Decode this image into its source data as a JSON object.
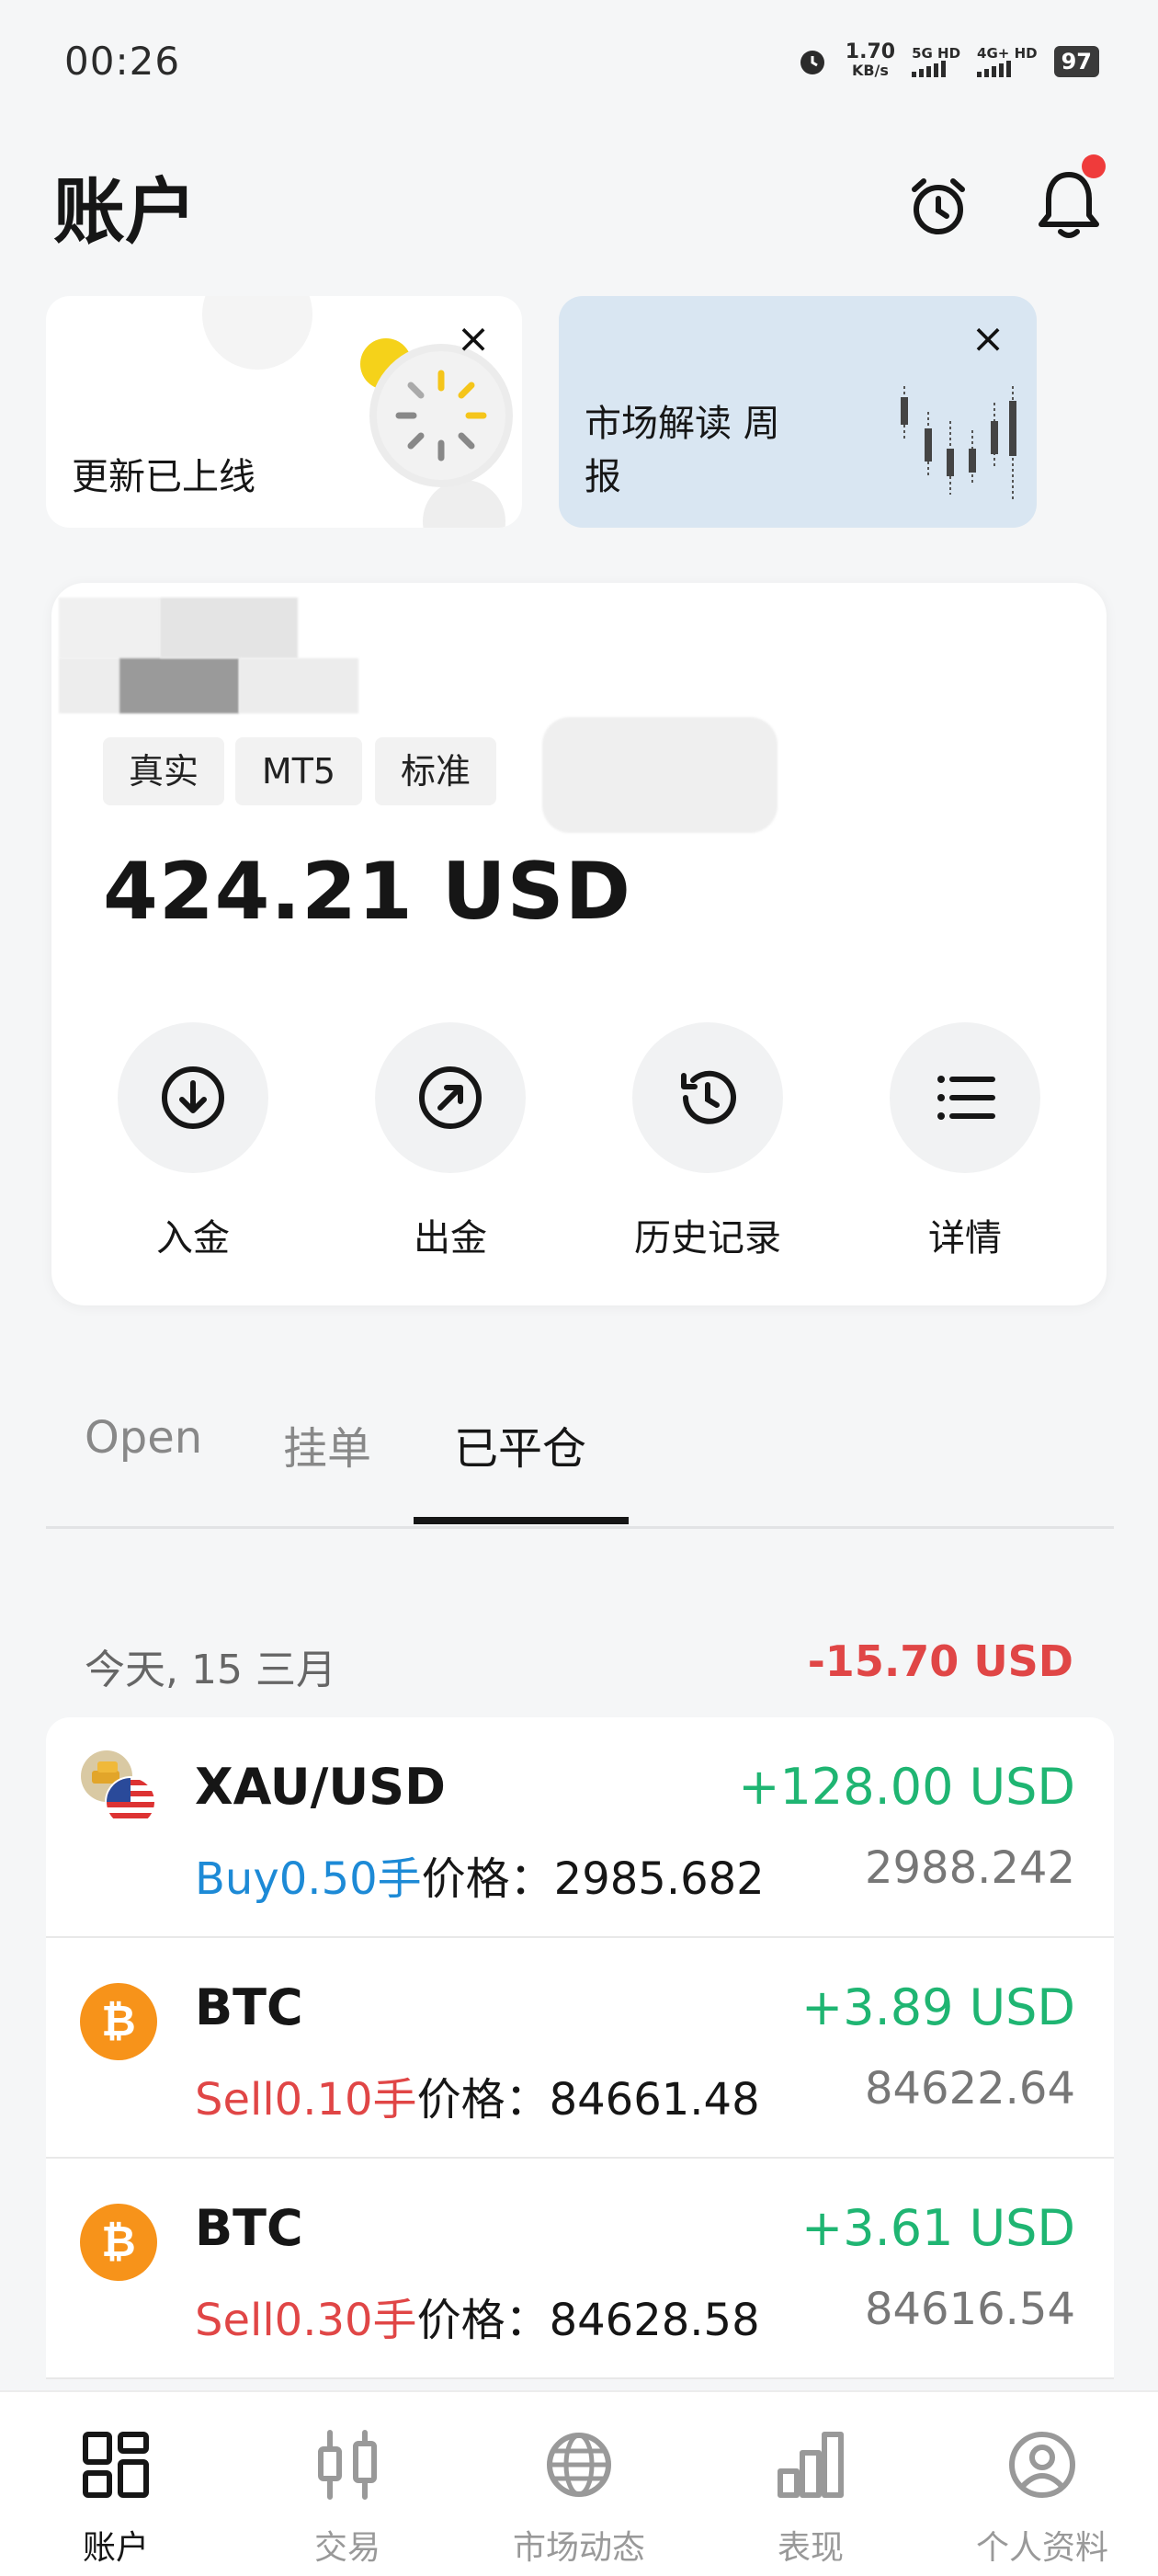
{
  "status_bar": {
    "time": "00:26",
    "speed_value": "1.70",
    "speed_unit": "KB/s",
    "sim1": "5G HD",
    "sim2": "4G+ HD",
    "battery": "97"
  },
  "header": {
    "title": "账户",
    "alarm_icon": "alarm-clock-icon",
    "bell_icon": "bell-icon",
    "has_notification": true
  },
  "banners": [
    {
      "text": "更新已上线"
    },
    {
      "text_line1": "市场解读 周",
      "text_line2": "报"
    }
  ],
  "account": {
    "tags": [
      "真实",
      "MT5",
      "标准"
    ],
    "balance": "424.21 USD",
    "actions": [
      {
        "label": "入金",
        "icon": "deposit-icon"
      },
      {
        "label": "出金",
        "icon": "withdraw-icon"
      },
      {
        "label": "历史记录",
        "icon": "history-icon"
      },
      {
        "label": "详情",
        "icon": "list-icon"
      }
    ]
  },
  "tabs": [
    {
      "label": "Open",
      "active": false
    },
    {
      "label": "挂单",
      "active": false
    },
    {
      "label": "已平仓",
      "active": true
    }
  ],
  "day_group": {
    "date": "今天, 15 三月",
    "total": "-15.70 USD"
  },
  "trades": [
    {
      "symbol": "XAU/USD",
      "pnl": "+128.00 USD",
      "side": "Buy",
      "lots": "0.50",
      "lots_unit": "手",
      "price_label": "价格：",
      "open_price": "2985.682",
      "close_price": "2988.242",
      "icon": "gold-usd-icon"
    },
    {
      "symbol": "BTC",
      "pnl": "+3.89 USD",
      "side": "Sell",
      "lots": "0.10",
      "lots_unit": "手",
      "price_label": "价格：",
      "open_price": "84661.48",
      "close_price": "84622.64",
      "icon": "bitcoin-icon"
    },
    {
      "symbol": "BTC",
      "pnl": "+3.61 USD",
      "side": "Sell",
      "lots": "0.30",
      "lots_unit": "手",
      "price_label": "价格：",
      "open_price": "84628.58",
      "close_price": "84616.54",
      "icon": "bitcoin-icon"
    }
  ],
  "bottom_nav": [
    {
      "label": "账户",
      "active": true,
      "icon": "dashboard-icon"
    },
    {
      "label": "交易",
      "active": false,
      "icon": "candlestick-icon"
    },
    {
      "label": "市场动态",
      "active": false,
      "icon": "globe-icon"
    },
    {
      "label": "表现",
      "active": false,
      "icon": "bar-chart-icon"
    },
    {
      "label": "个人资料",
      "active": false,
      "icon": "user-circle-icon"
    }
  ],
  "colors": {
    "profit": "#1fb572",
    "loss": "#e04646",
    "buy": "#1d8ad6",
    "accent_dot": "#ef3b3b"
  }
}
